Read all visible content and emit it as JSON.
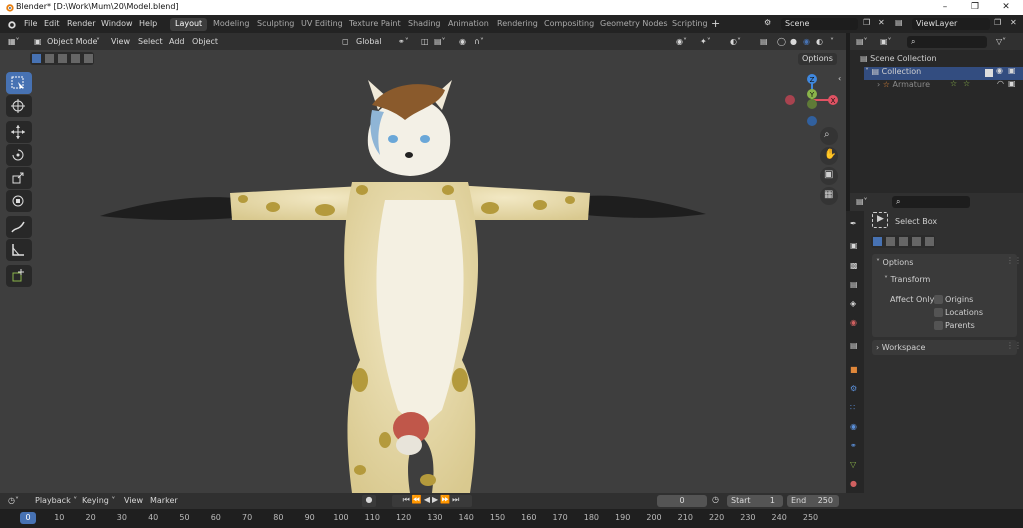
{
  "window": {
    "title": "Blender* [D:\\Work\\Mum\\20\\Model.blend]"
  },
  "menu": [
    "File",
    "Edit",
    "Render",
    "Window",
    "Help"
  ],
  "workspaces": [
    "Layout",
    "Modeling",
    "Sculpting",
    "UV Editing",
    "Texture Paint",
    "Shading",
    "Animation",
    "Rendering",
    "Compositing",
    "Geometry Nodes",
    "Scripting"
  ],
  "active_workspace": "Layout",
  "scene_name": "Scene",
  "view_layer": "ViewLayer",
  "viewport": {
    "mode": "Object Mode",
    "menus": [
      "View",
      "Select",
      "Add",
      "Object"
    ],
    "orientation": "Global",
    "options_label": "Options",
    "gizmo_axes": {
      "z": "Z",
      "y": "Y",
      "x": "X"
    },
    "colors": {
      "bg": "#3e3e3e",
      "axis_x": "#e05263",
      "axis_y": "#8ab44a",
      "axis_z": "#3f88df",
      "active_tool": "#4772b3"
    }
  },
  "outliner": {
    "search_placeholder": "",
    "items": [
      {
        "label": "Scene Collection",
        "level": 0
      },
      {
        "label": "Collection",
        "level": 1
      },
      {
        "label": "Armature",
        "level": 2
      }
    ]
  },
  "properties": {
    "tool_name": "Select Box",
    "options_label": "Options",
    "transform_label": "Transform",
    "affect_only_label": "Affect Only",
    "checkboxes": [
      "Origins",
      "Locations",
      "Parents"
    ],
    "workspace_label": "Workspace"
  },
  "timeline": {
    "menus": [
      "Playback",
      "Keying",
      "View",
      "Marker"
    ],
    "current_frame": "0",
    "start_label": "Start",
    "start": "1",
    "end_label": "End",
    "end": "250",
    "ticks": [
      "0",
      "10",
      "20",
      "30",
      "40",
      "50",
      "60",
      "70",
      "80",
      "90",
      "100",
      "110",
      "120",
      "130",
      "140",
      "150",
      "160",
      "170",
      "180",
      "190",
      "200",
      "210",
      "220",
      "230",
      "240",
      "250"
    ]
  }
}
